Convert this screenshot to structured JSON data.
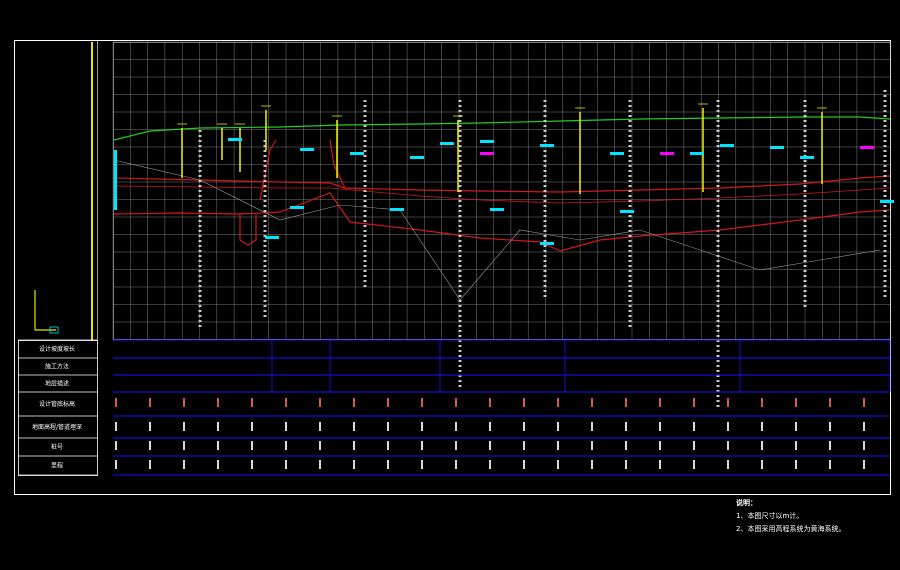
{
  "drawing": {
    "row_labels": [
      "设计坡度坡长",
      "施工方法",
      "地层描述",
      "设计管底标高",
      "地面高程/管道埋深",
      "桩号",
      "里程"
    ],
    "notes": {
      "title": "说明：",
      "items": [
        "1、本图尺寸以m计。",
        "2、本图采用高程系统为黄海系统。"
      ]
    },
    "colors": {
      "background": "#000000",
      "grid": "#9a9a9a",
      "frame": "#ffffff",
      "table_lines": "#1414ff",
      "ground_line": "#22cc22",
      "pipe": "#d01818",
      "borehole": "#e6e600",
      "annotation_cyan": "#00e5ff",
      "annotation_magenta": "#ff00ff",
      "data_text": "#ff6666"
    }
  }
}
